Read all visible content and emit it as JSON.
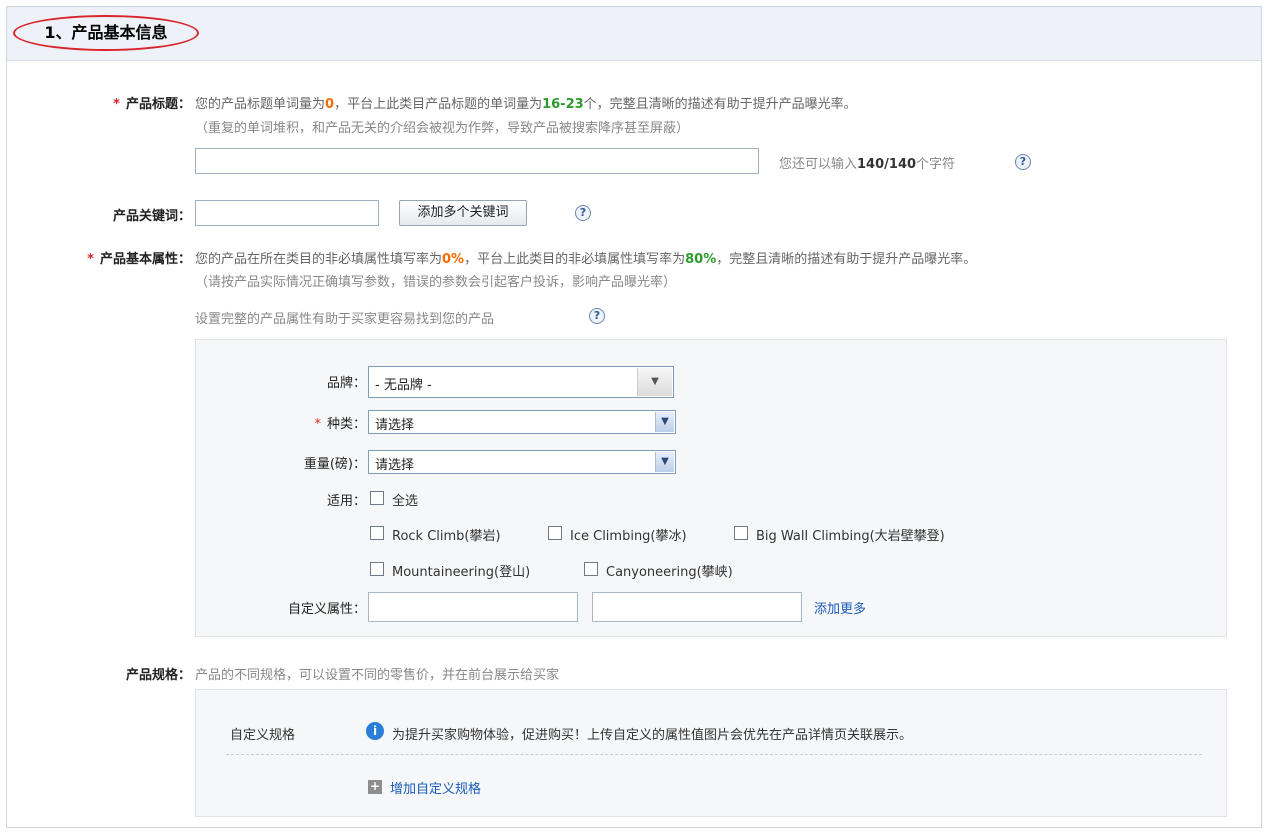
{
  "section_title": "1、产品基本信息",
  "product_title": {
    "label": "产品标题：",
    "line1": {
      "pre": "您的产品标题单词量为",
      "count": "0",
      "mid": "，平台上此类目产品标题的单词量为",
      "range": "16-23",
      "post": "个，完整且清晰的描述有助于提升产品曝光率。"
    },
    "line2": "（重复的单词堆积，和产品无关的介绍会被视为作弊，导致产品被搜索降序甚至屏蔽）",
    "input_value": "",
    "remaining_pre": "您还可以输入",
    "remaining_count": "140/140",
    "remaining_post": "个字符"
  },
  "keywords": {
    "label": "产品关键词：",
    "input_value": "",
    "add_button": "添加多个关键词"
  },
  "attributes": {
    "label": "产品基本属性：",
    "line1": {
      "pre": "您的产品在所在类目的非必填属性填写率为",
      "own_rate": "0%",
      "mid": "，平台上此类目的非必填属性填写率为",
      "platform_rate": "80%",
      "post": "，完整且清晰的描述有助于提升产品曝光率。"
    },
    "line2": "（请按产品实际情况正确填写参数，错误的参数会引起客户投诉，影响产品曝光率）",
    "hint": "设置完整的产品属性有助于买家更容易找到您的产品",
    "brand": {
      "label": "品牌：",
      "value": "- 无品牌 -"
    },
    "category": {
      "label": "种类：",
      "value": "请选择"
    },
    "weight": {
      "label": "重量(磅)：",
      "value": "请选择"
    },
    "applicable": {
      "label": "适用：",
      "select_all": "全选",
      "options": [
        "Rock Climb(攀岩)",
        "Ice Climbing(攀冰)",
        "Big Wall Climbing(大岩壁攀登)",
        "Mountaineering(登山)",
        "Canyoneering(攀峡)"
      ]
    },
    "custom": {
      "label": "自定义属性：",
      "name_value": "",
      "value_value": "",
      "add_more": "添加更多"
    }
  },
  "specs": {
    "label": "产品规格：",
    "desc": "产品的不同规格，可以设置不同的零售价，并在前台展示给买家",
    "custom_label": "自定义规格",
    "info_text": "为提升买家购物体验，促进购买！上传自定义的属性值图片会优先在产品详情页关联展示。",
    "add_link": "增加自定义规格"
  },
  "icons": {
    "help": "question-icon",
    "info": "info-icon",
    "plus": "plus-icon",
    "dropdown": "chevron-down-icon"
  },
  "colors": {
    "required": "#d8252b",
    "orange_value": "#ff6a00",
    "green_value": "#2c9a2c",
    "link": "#1a5bb8",
    "header_bg": "#eef2f8"
  }
}
